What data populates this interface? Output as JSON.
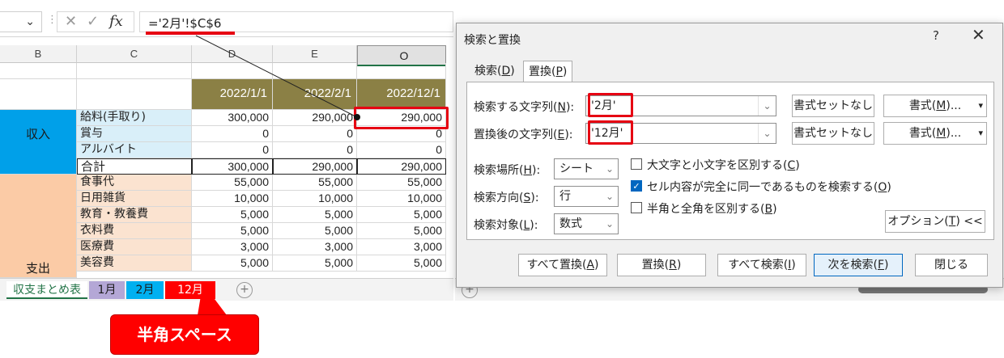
{
  "formula_bar": {
    "formula": "='2月'!$C$6",
    "fx_label": "fx"
  },
  "columns": [
    "B",
    "C",
    "D",
    "E",
    "O"
  ],
  "header_dates": [
    "2022/1/1",
    "2022/2/1",
    "2022/12/1"
  ],
  "income": {
    "group_label": "収入",
    "rows": [
      {
        "label": "給料(手取り)",
        "d": "300,000",
        "e": "290,000",
        "o": "290,000"
      },
      {
        "label": "賞与",
        "d": "0",
        "e": "0",
        "o": "0"
      },
      {
        "label": "アルバイト",
        "d": "0",
        "e": "0",
        "o": "0"
      }
    ]
  },
  "total": {
    "label": "合計",
    "d": "300,000",
    "e": "290,000",
    "o": "290,000"
  },
  "expense": {
    "group_label": "支出",
    "rows": [
      {
        "label": "食事代",
        "d": "55,000",
        "e": "55,000",
        "o": "55,000"
      },
      {
        "label": "日用雑貨",
        "d": "10,000",
        "e": "10,000",
        "o": "10,000"
      },
      {
        "label": "教育・教養費",
        "d": "5,000",
        "e": "5,000",
        "o": "5,000"
      },
      {
        "label": "衣料費",
        "d": "5,000",
        "e": "5,000",
        "o": "5,000"
      },
      {
        "label": "医療費",
        "d": "3,000",
        "e": "3,000",
        "o": "3,000"
      },
      {
        "label": "美容費",
        "d": "5,000",
        "e": "5,000",
        "o": "5,000"
      }
    ]
  },
  "sheet_tabs": [
    "収支まとめ表",
    "1月",
    "2月",
    "12月"
  ],
  "callout": "半角スペース",
  "dialog": {
    "title": "検索と置換",
    "help": "?",
    "close": "✕",
    "tab_find": {
      "label": "検索(",
      "key": "D",
      "end": ")"
    },
    "tab_replace": {
      "label": "置換(",
      "key": "P",
      "end": ")"
    },
    "find_label": {
      "label": "検索する文字列(",
      "key": "N",
      "end": "):"
    },
    "find_value": "'2月'",
    "replace_label": {
      "label": "置換後の文字列(",
      "key": "E",
      "end": "):"
    },
    "replace_value": "'12月'",
    "no_format": "書式セットなし",
    "format_btn": {
      "label": "書式(",
      "key": "M",
      "end": ")..."
    },
    "within_label": {
      "label": "検索場所(",
      "key": "H",
      "end": "):"
    },
    "within_value": "シート",
    "search_label": {
      "label": "検索方向(",
      "key": "S",
      "end": "):"
    },
    "search_value": "行",
    "lookin_label": {
      "label": "検索対象(",
      "key": "L",
      "end": "):"
    },
    "lookin_value": "数式",
    "opt_case": {
      "label": "大文字と小文字を区別する(",
      "key": "C",
      "end": ")",
      "checked": false
    },
    "opt_entire": {
      "label": "セル内容が完全に同一であるものを検索する(",
      "key": "O",
      "end": ")",
      "checked": true
    },
    "opt_width": {
      "label": "半角と全角を区別する(",
      "key": "B",
      "end": ")",
      "checked": false
    },
    "options_btn": {
      "label": "オプション(",
      "key": "T",
      "end": ") <<"
    },
    "buttons": {
      "replace_all": {
        "label": "すべて置換(",
        "key": "A",
        "end": ")"
      },
      "replace": {
        "label": "置換(",
        "key": "R",
        "end": ")"
      },
      "find_all": {
        "label": "すべて検索(",
        "key": "I",
        "end": ")"
      },
      "find_next": {
        "label": "次を検索(",
        "key": "F",
        "end": ")"
      },
      "close": "閉じる"
    }
  },
  "colors": {
    "accent_red": "#e60012",
    "excel_green": "#217346",
    "date_header": "#8b8045",
    "income_blue": "#00a0e9",
    "expense_peach": "#fbcba6"
  }
}
